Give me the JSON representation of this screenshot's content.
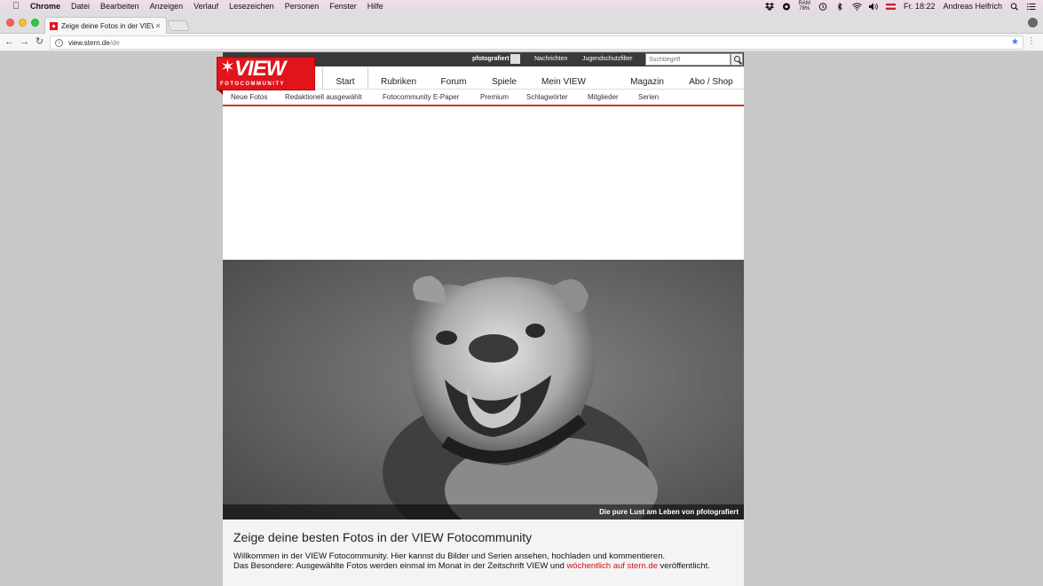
{
  "menubar": {
    "app_name": "Chrome",
    "items": [
      "Datei",
      "Bearbeiten",
      "Anzeigen",
      "Verlauf",
      "Lesezeichen",
      "Personen",
      "Fenster",
      "Hilfe"
    ],
    "ram_label": "RAM",
    "ram_value": "78%",
    "clock": "Fr. 18:22",
    "user": "Andreas Helfrich"
  },
  "browser": {
    "tab_title": "Zeige deine Fotos in der VIEW",
    "tab_close": "×",
    "url_host": "view.stern.de",
    "url_path": "/de"
  },
  "site": {
    "topstrip": {
      "user": "pfotografiert",
      "links": [
        "Nachrichten",
        "Jugendschutzfilter"
      ],
      "search_placeholder": "Suchbegriff"
    },
    "logo": {
      "brand": "VIEW",
      "sub": "FOTOCOMMUNITY"
    },
    "mainnav": [
      "Start",
      "Rubriken",
      "Forum",
      "Spiele",
      "Mein VIEW",
      "Magazin",
      "Abo / Shop"
    ],
    "subnav": [
      "Neue Fotos",
      "Redaktionell ausgewählt",
      "Fotocommunity E-Paper",
      "Premium",
      "Schlagwörter",
      "Mitglieder",
      "Serien"
    ],
    "hero_caption": "Die pure Lust am Leben von pfotografiert",
    "intro": {
      "title": "Zeige deine besten Fotos in der VIEW Fotocommunity",
      "line1": "Willkommen in der VIEW Fotocommunity. Hier kannst du Bilder und Serien ansehen, hochladen und kommentieren.",
      "line2_prefix": "Das Besondere: Ausgewählte Fotos werden einmal im Monat in der Zeitschrift VIEW und ",
      "line2_link": "wöchentlich auf stern.de",
      "line2_suffix": " veröffentlicht."
    }
  },
  "colors": {
    "brand_red": "#e2141b",
    "accent_line": "#c0391b",
    "bookmark_star": "#3b7ee8"
  }
}
